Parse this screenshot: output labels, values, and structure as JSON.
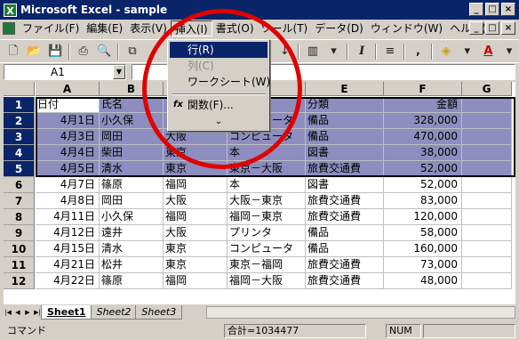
{
  "window": {
    "title": "Microsoft Excel - sample",
    "app_icon": "X"
  },
  "menu": {
    "items": [
      "ファイル(F)",
      "編集(E)",
      "表示(V)",
      "挿入(I)",
      "書式(O)",
      "ツール(T)",
      "データ(D)",
      "ウィンドウ(W)",
      "ヘルプ(H)"
    ],
    "active_index": 3
  },
  "formula": {
    "name_box": "A1",
    "formula_value": ""
  },
  "columns": [
    "A",
    "B",
    "C",
    "D",
    "E",
    "F",
    "G"
  ],
  "rows": [
    {
      "num": "1",
      "cells": [
        "日付",
        "氏名",
        "",
        "",
        "分類",
        "金額",
        ""
      ]
    },
    {
      "num": "2",
      "cells": [
        "4月1日",
        "小久保",
        "",
        "コンピュータ",
        "備品",
        "328,000",
        ""
      ]
    },
    {
      "num": "3",
      "cells": [
        "4月3日",
        "岡田",
        "大阪",
        "コンピュータ",
        "備品",
        "470,000",
        ""
      ]
    },
    {
      "num": "4",
      "cells": [
        "4月4日",
        "柴田",
        "東京",
        "本",
        "図書",
        "38,000",
        ""
      ]
    },
    {
      "num": "5",
      "cells": [
        "4月5日",
        "清水",
        "東京",
        "東京－大阪",
        "旅費交通費",
        "52,000",
        ""
      ]
    },
    {
      "num": "6",
      "cells": [
        "4月7日",
        "篠原",
        "福岡",
        "本",
        "図書",
        "52,000",
        ""
      ]
    },
    {
      "num": "7",
      "cells": [
        "4月8日",
        "岡田",
        "大阪",
        "大阪－東京",
        "旅費交通費",
        "83,000",
        ""
      ]
    },
    {
      "num": "8",
      "cells": [
        "4月11日",
        "小久保",
        "福岡",
        "福岡－東京",
        "旅費交通費",
        "120,000",
        ""
      ]
    },
    {
      "num": "9",
      "cells": [
        "4月12日",
        "遠井",
        "大阪",
        "プリンタ",
        "備品",
        "58,000",
        ""
      ]
    },
    {
      "num": "10",
      "cells": [
        "4月15日",
        "清水",
        "東京",
        "コンピュータ",
        "備品",
        "160,000",
        ""
      ]
    },
    {
      "num": "11",
      "cells": [
        "4月21日",
        "松井",
        "東京",
        "東京－福岡",
        "旅費交通費",
        "73,000",
        ""
      ]
    },
    {
      "num": "12",
      "cells": [
        "4月22日",
        "篠原",
        "福岡",
        "福岡－大阪",
        "旅費交通費",
        "48,000",
        ""
      ]
    }
  ],
  "sheets": [
    "Sheet1",
    "Sheet2",
    "Sheet3"
  ],
  "status": {
    "mode": "コマンド",
    "sum": "合計=1034477",
    "num": "NUM"
  },
  "insert_menu": {
    "items": [
      {
        "label": "行(R)",
        "highlighted": true,
        "disabled": false
      },
      {
        "label": "列(C)",
        "highlighted": false,
        "disabled": true
      },
      {
        "label": "ワークシート(W)",
        "highlighted": false,
        "disabled": false
      },
      {
        "label": "関数(F)...",
        "highlighted": false,
        "disabled": false
      }
    ],
    "function_icon": "fx",
    "expand": "⌄"
  },
  "colors": {
    "selection": "#8d8dbf",
    "title_bar": "#0a246a",
    "highlight_circle": "#e10000"
  }
}
